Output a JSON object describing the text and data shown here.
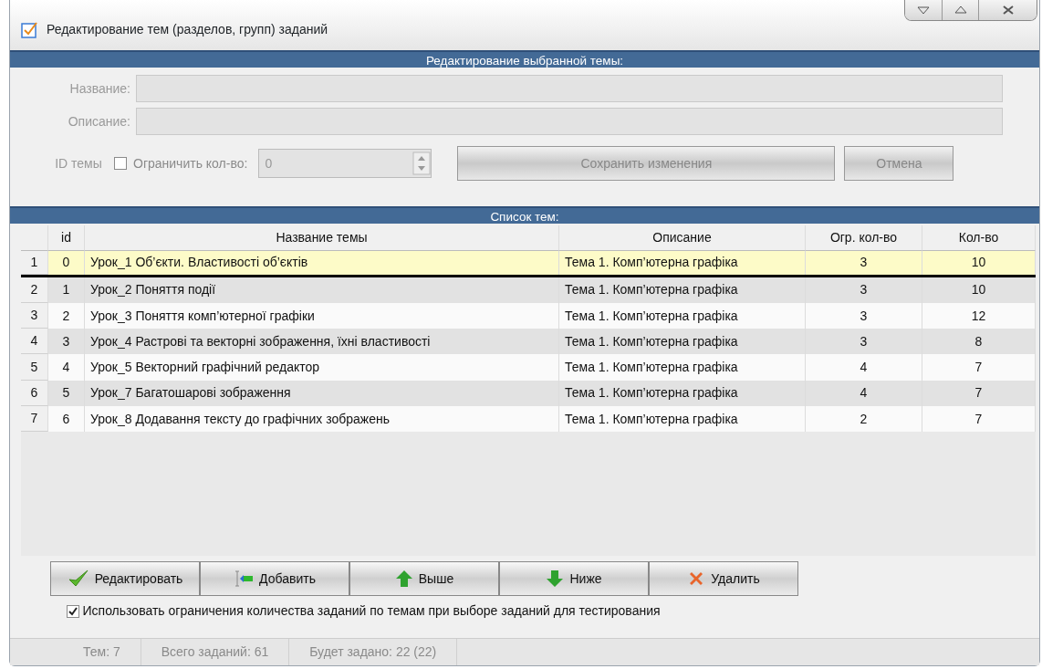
{
  "window": {
    "title": "Редактирование тем (разделов, групп) заданий"
  },
  "editor": {
    "header": "Редактирование выбранной темы:",
    "disabled": true,
    "name_label": "Название:",
    "description_label": "Описание:",
    "id_label": "ID темы",
    "limit_checkbox": {
      "label": "Ограничить кол-во:",
      "checked": false
    },
    "limit_value": "0",
    "save_button": "Сохранить изменения",
    "cancel_button": "Отмена"
  },
  "table": {
    "header": "Список тем:",
    "columns": [
      "id",
      "Название темы",
      "Описание",
      "Огр. кол-во",
      "Кол-во"
    ],
    "rows": [
      {
        "row_number": "1",
        "id": "0",
        "name": "Урок_1 Об’єкти. Властивості об’єктів",
        "description": "Тема 1. Комп’ютерна графіка",
        "limit": "3",
        "count": "10",
        "selected": true
      },
      {
        "row_number": "2",
        "id": "1",
        "name": "Урок_2 Поняття події",
        "description": "Тема 1. Комп’ютерна графіка",
        "limit": "3",
        "count": "10",
        "selected": false
      },
      {
        "row_number": "3",
        "id": "2",
        "name": "Урок_3 Поняття комп’ютерної графіки",
        "description": "Тема 1. Комп’ютерна графіка",
        "limit": "3",
        "count": "12",
        "selected": false
      },
      {
        "row_number": "4",
        "id": "3",
        "name": "Урок_4 Растрові та векторні зображення, їхні властивості",
        "description": "Тема 1. Комп’ютерна графіка",
        "limit": "3",
        "count": "8",
        "selected": false
      },
      {
        "row_number": "5",
        "id": "4",
        "name": "Урок_5 Векторний графічний редактор",
        "description": "Тема 1. Комп’ютерна графіка",
        "limit": "4",
        "count": "7",
        "selected": false
      },
      {
        "row_number": "6",
        "id": "5",
        "name": "Урок_7 Багатошарові зображення",
        "description": "Тема 1. Комп’ютерна графіка",
        "limit": "4",
        "count": "7",
        "selected": false
      },
      {
        "row_number": "7",
        "id": "6",
        "name": "Урок_8 Додавання тексту до графічних зображень",
        "description": "Тема 1. Комп’ютерна графіка",
        "limit": "2",
        "count": "7",
        "selected": false
      }
    ]
  },
  "buttons": [
    {
      "label": "Редактировать",
      "kind": "check"
    },
    {
      "label": "Добавить",
      "kind": "add"
    },
    {
      "label": "Выше",
      "kind": "up"
    },
    {
      "label": "Ниже",
      "kind": "down"
    },
    {
      "label": "Удалить",
      "kind": "delete"
    }
  ],
  "use_limits": {
    "label": "Использовать ограничения количества заданий по темам при выборе заданий для тестирования",
    "checked": true
  },
  "status_bar": [
    "Тем: 7",
    "Всего заданий: 61",
    "Будет задано: 22 (22)"
  ]
}
